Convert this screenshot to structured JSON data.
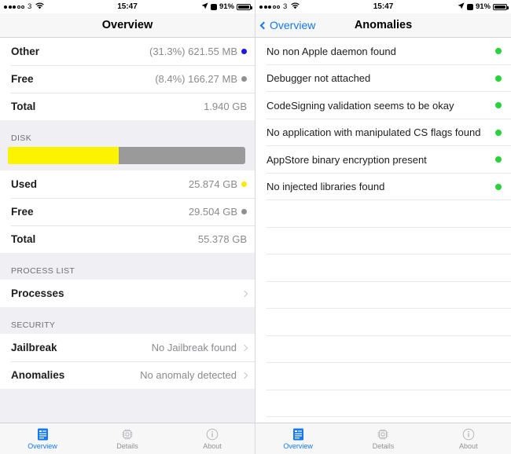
{
  "status_bar": {
    "carrier": "3",
    "time": "15:47",
    "battery_percent": "91%",
    "signal_filled": 3,
    "signal_empty": 2,
    "wifi_icon": "wifi-icon",
    "location_icon": "location-arrow-icon",
    "alarm_icon": "alarm-icon",
    "battery_icon": "battery-icon"
  },
  "left": {
    "nav": {
      "title": "Overview"
    },
    "memory_rows": [
      {
        "label": "Other",
        "value": "(31.3%) 621.55 MB",
        "dot": "#1A1AE6"
      },
      {
        "label": "Free",
        "value": "(8.4%) 166.27 MB",
        "dot": "#8E8E93"
      },
      {
        "label": "Total",
        "value": "1.940 GB",
        "dot": ""
      }
    ],
    "disk": {
      "header": "DISK",
      "bar_fill_percent": 46.7,
      "bar_fill_color": "#FCF300",
      "bar_track_color": "#9A9A9A",
      "rows": [
        {
          "label": "Used",
          "value": "25.874 GB",
          "dot": "#FDE800"
        },
        {
          "label": "Free",
          "value": "29.504 GB",
          "dot": "#8E8E93"
        },
        {
          "label": "Total",
          "value": "55.378 GB",
          "dot": ""
        }
      ]
    },
    "process_list": {
      "header": "PROCESS LIST",
      "rows": [
        {
          "label": "Processes",
          "value": "",
          "chevron": true
        }
      ]
    },
    "security": {
      "header": "SECURITY",
      "rows": [
        {
          "label": "Jailbreak",
          "value": "No Jailbreak found",
          "chevron": true
        },
        {
          "label": "Anomalies",
          "value": "No anomaly detected",
          "chevron": true
        }
      ]
    }
  },
  "right": {
    "nav": {
      "back_label": "Overview",
      "title": "Anomalies"
    },
    "anomalies": [
      {
        "text": "No non Apple daemon found",
        "status_color": "#27D23A"
      },
      {
        "text": "Debugger not attached",
        "status_color": "#27D23A"
      },
      {
        "text": "CodeSigning validation seems to be okay",
        "status_color": "#27D23A"
      },
      {
        "text": "No application with manipulated CS flags found",
        "status_color": "#27D23A"
      },
      {
        "text": "AppStore binary encryption present",
        "status_color": "#27D23A"
      },
      {
        "text": "No injected libraries found",
        "status_color": "#27D23A"
      }
    ],
    "empty_rows": 8
  },
  "tabs": [
    {
      "label": "Overview",
      "icon": "document-list-icon",
      "active": true
    },
    {
      "label": "Details",
      "icon": "chip-icon",
      "active": false
    },
    {
      "label": "About",
      "icon": "info-circle-icon",
      "active": false
    }
  ],
  "colors": {
    "accent": "#1278F3",
    "group_bg": "#EFEFF4",
    "separator": "#E4E4E6"
  }
}
